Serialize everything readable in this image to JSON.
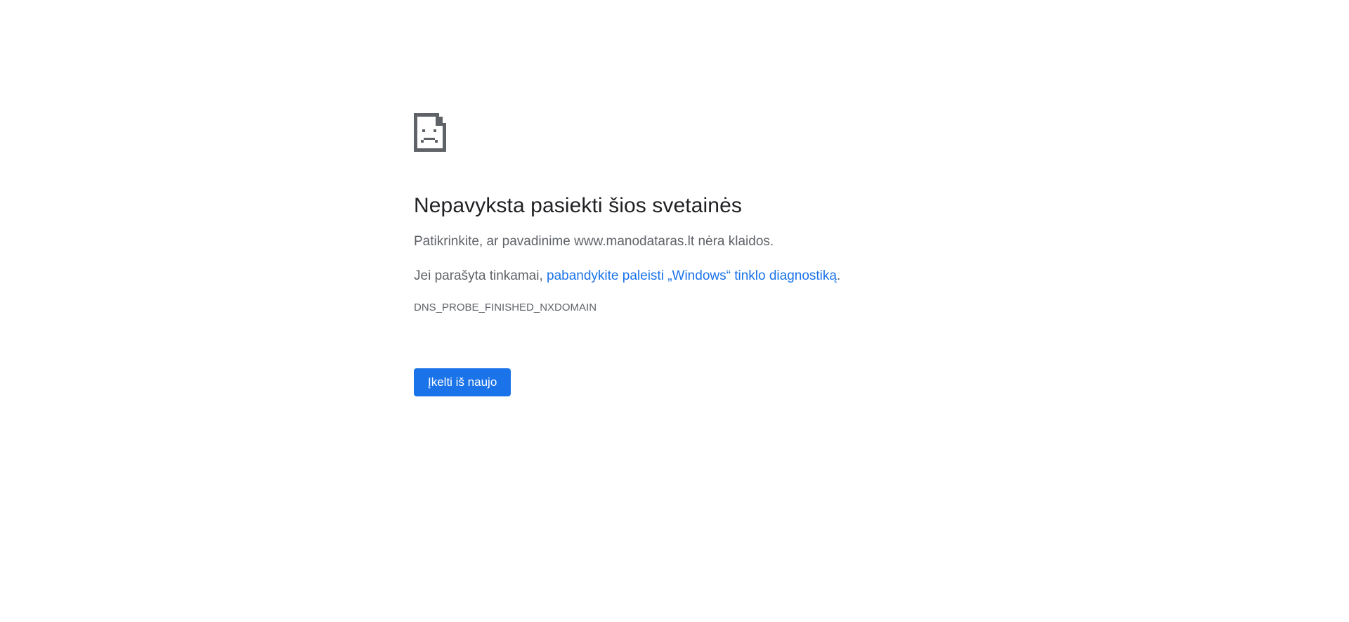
{
  "error": {
    "icon": "sad-document-icon",
    "title": "Nepavyksta pasiekti šios svetainės",
    "check_text": "Patikrinkite, ar pavadinime www.manodataras.lt nėra klaidos.",
    "suggestion_prefix": "Jei parašyta tinkamai, ",
    "suggestion_link": "pabandykite paleisti „Windows“ tinklo diagnostiką",
    "suggestion_suffix": ".",
    "code": "DNS_PROBE_FINISHED_NXDOMAIN"
  },
  "actions": {
    "reload_label": "Įkelti iš naujo"
  },
  "colors": {
    "accent": "#1a73e8",
    "title": "#202124",
    "body": "#5f6368",
    "icon": "#5f6368"
  }
}
